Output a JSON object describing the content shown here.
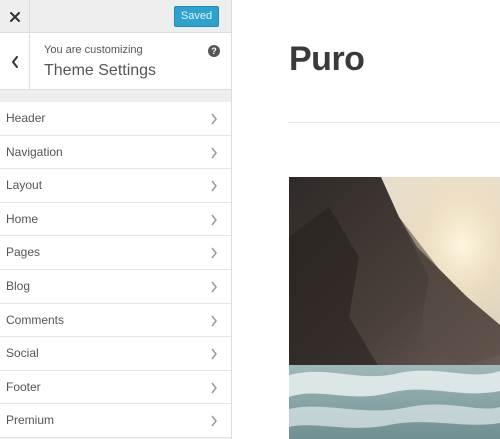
{
  "topbar": {
    "close_icon": "close-icon",
    "saved_label": "Saved"
  },
  "info": {
    "back_icon": "chevron-left-icon",
    "customizing_label": "You are customizing",
    "theme_title": "Theme Settings",
    "help_glyph": "?"
  },
  "sections": [
    {
      "label": "Header"
    },
    {
      "label": "Navigation"
    },
    {
      "label": "Layout"
    },
    {
      "label": "Home"
    },
    {
      "label": "Pages"
    },
    {
      "label": "Blog"
    },
    {
      "label": "Comments"
    },
    {
      "label": "Social"
    },
    {
      "label": "Footer"
    },
    {
      "label": "Premium"
    }
  ],
  "preview": {
    "site_title": "Puro"
  },
  "colors": {
    "accent": "#2ea2cc",
    "sidebar_bg": "#eeeeee",
    "text": "#555555"
  }
}
